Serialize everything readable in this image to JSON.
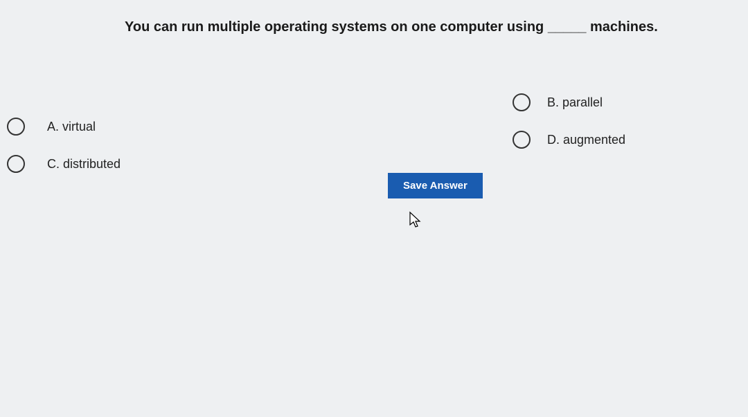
{
  "question": {
    "text": "You can run multiple operating systems on one computer using _____ machines."
  },
  "options": {
    "A": {
      "label": "A. virtual"
    },
    "B": {
      "label": "B. parallel"
    },
    "C": {
      "label": "C. distributed"
    },
    "D": {
      "label": "D. augmented"
    }
  },
  "actions": {
    "save_label": "Save Answer"
  }
}
